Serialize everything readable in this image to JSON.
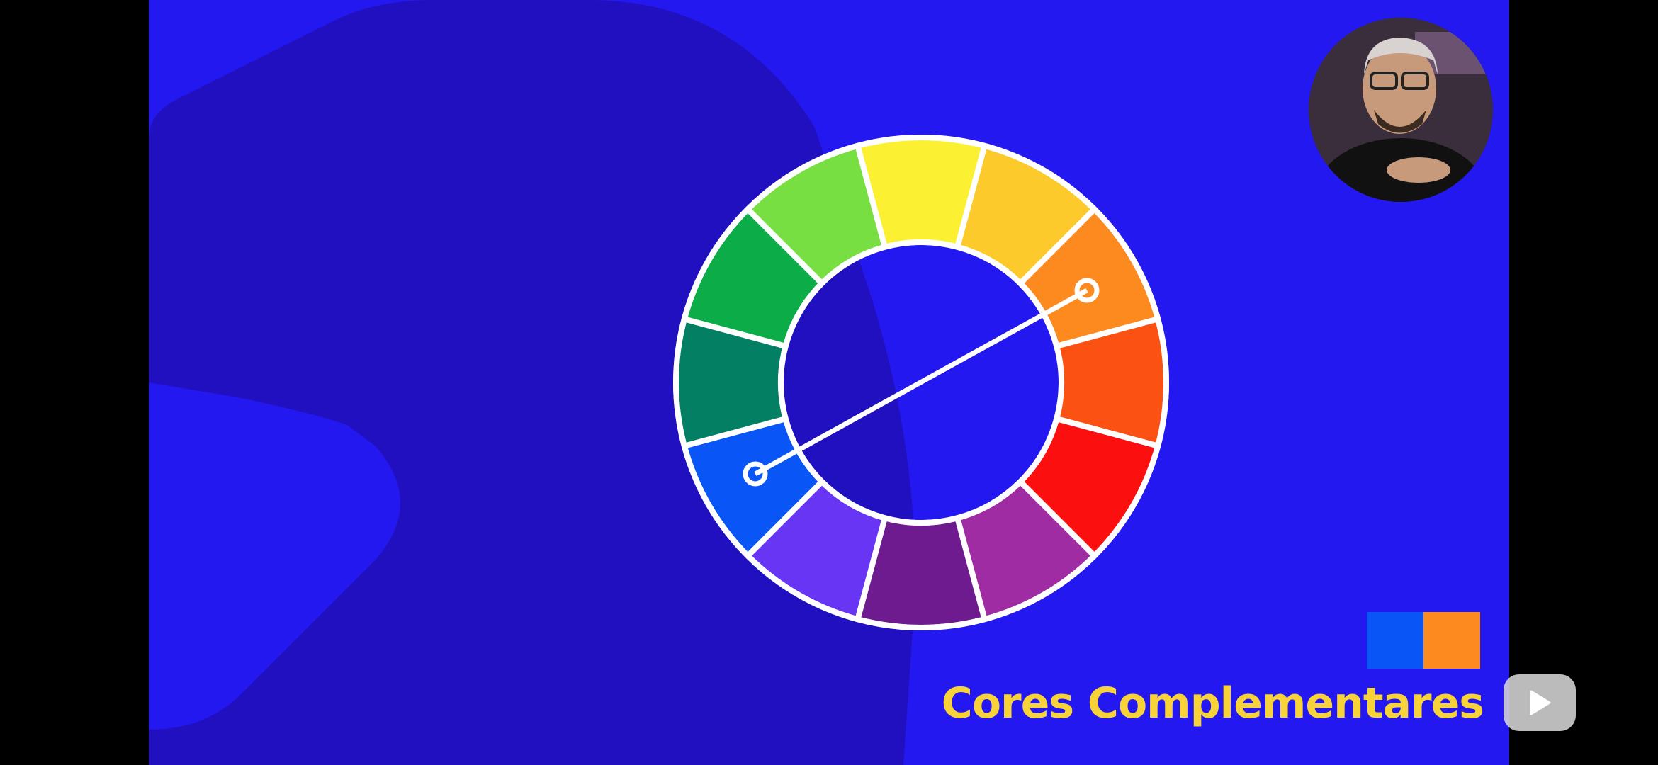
{
  "video": {
    "background_color": "#2418f0",
    "shape_color": "#2110c0",
    "caption": "Cores Complementares",
    "caption_color": "#f7d238",
    "swatches": [
      {
        "name": "blue",
        "color": "#0a55f5"
      },
      {
        "name": "orange",
        "color": "#fd8a1f"
      }
    ],
    "color_wheel": {
      "segments": [
        {
          "name": "yellow",
          "color": "#fbf031"
        },
        {
          "name": "yellow-orange",
          "color": "#fdca2b"
        },
        {
          "name": "orange",
          "color": "#fd8a1f"
        },
        {
          "name": "red-orange",
          "color": "#fb5214"
        },
        {
          "name": "red",
          "color": "#fb0f0f"
        },
        {
          "name": "red-violet",
          "color": "#a02ca3"
        },
        {
          "name": "violet",
          "color": "#6d1b8f"
        },
        {
          "name": "blue-violet",
          "color": "#6835f5"
        },
        {
          "name": "blue",
          "color": "#0a55f5"
        },
        {
          "name": "blue-green",
          "color": "#038064"
        },
        {
          "name": "green",
          "color": "#0cad48"
        },
        {
          "name": "yellow-green",
          "color": "#77df41"
        }
      ],
      "complementary_pair": [
        "blue",
        "orange"
      ]
    },
    "webcam_icon": "presenter-video"
  },
  "controls": {
    "play_icon": "play-icon"
  }
}
